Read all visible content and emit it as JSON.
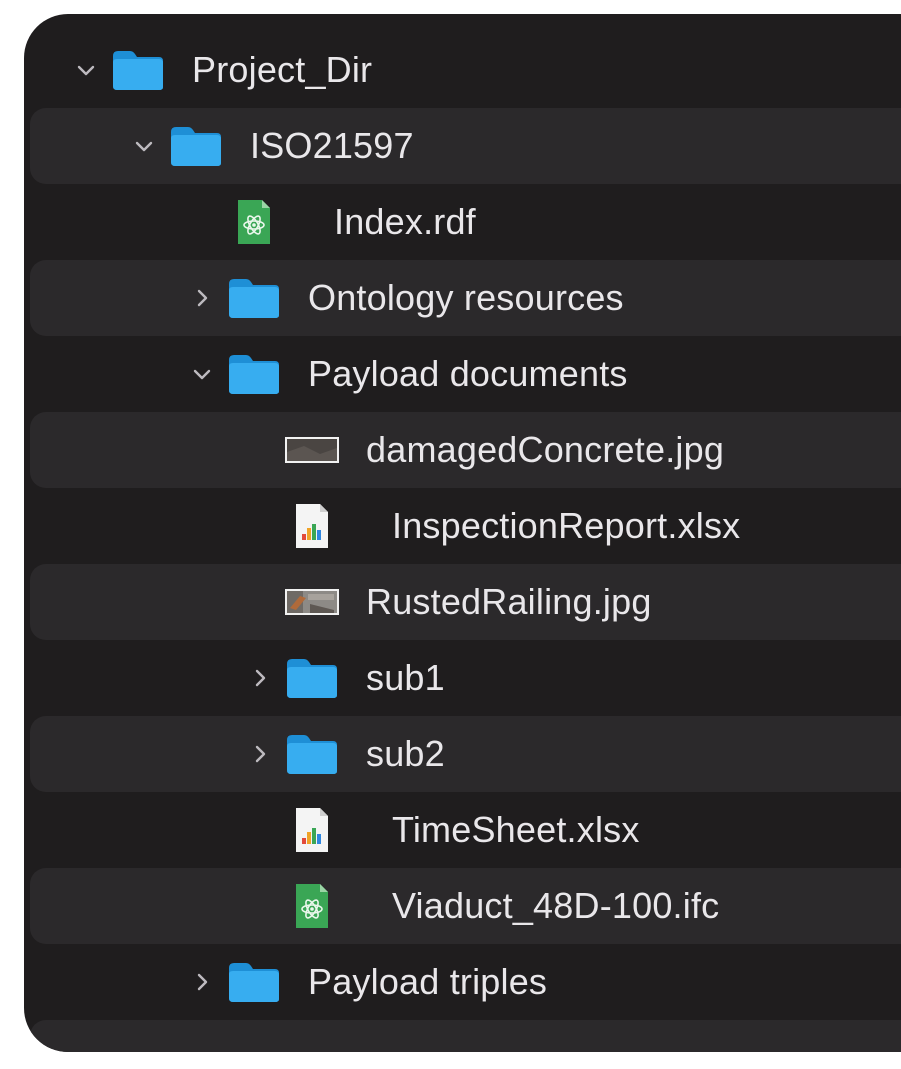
{
  "tree": {
    "rows": [
      {
        "label": "Project_Dir",
        "level": 0,
        "kind": "folder",
        "state": "expanded",
        "alt": false
      },
      {
        "label": "ISO21597",
        "level": 1,
        "kind": "folder",
        "state": "expanded",
        "alt": true
      },
      {
        "label": "Index.rdf",
        "level": 2,
        "kind": "rdf",
        "state": "none",
        "alt": false
      },
      {
        "label": "Ontology resources",
        "level": 2,
        "kind": "folder",
        "state": "collapsed",
        "alt": true
      },
      {
        "label": "Payload documents",
        "level": 2,
        "kind": "folder",
        "state": "expanded",
        "alt": false
      },
      {
        "label": "damagedConcrete.jpg",
        "level": 3,
        "kind": "image-dark",
        "state": "none",
        "alt": true
      },
      {
        "label": "InspectionReport.xlsx",
        "level": 3,
        "kind": "xlsx",
        "state": "none",
        "alt": false
      },
      {
        "label": "RustedRailing.jpg",
        "level": 3,
        "kind": "image-rust",
        "state": "none",
        "alt": true
      },
      {
        "label": "sub1",
        "level": 3,
        "kind": "folder",
        "state": "collapsed",
        "alt": false
      },
      {
        "label": "sub2",
        "level": 3,
        "kind": "folder",
        "state": "collapsed",
        "alt": true
      },
      {
        "label": "TimeSheet.xlsx",
        "level": 3,
        "kind": "xlsx",
        "state": "none",
        "alt": false
      },
      {
        "label": "Viaduct_48D-100.ifc",
        "level": 3,
        "kind": "rdf",
        "state": "none",
        "alt": true
      },
      {
        "label": "Payload triples",
        "level": 2,
        "kind": "folder",
        "state": "collapsed",
        "alt": false
      },
      {
        "label": "",
        "level": 0,
        "kind": "empty",
        "state": "none",
        "alt": true
      }
    ]
  },
  "colors": {
    "background": "#1f1d1e",
    "alt_row": "#2b292b",
    "text": "#e9e7ea",
    "folder": "#2fa4e7",
    "rdf_green": "#39a951"
  }
}
